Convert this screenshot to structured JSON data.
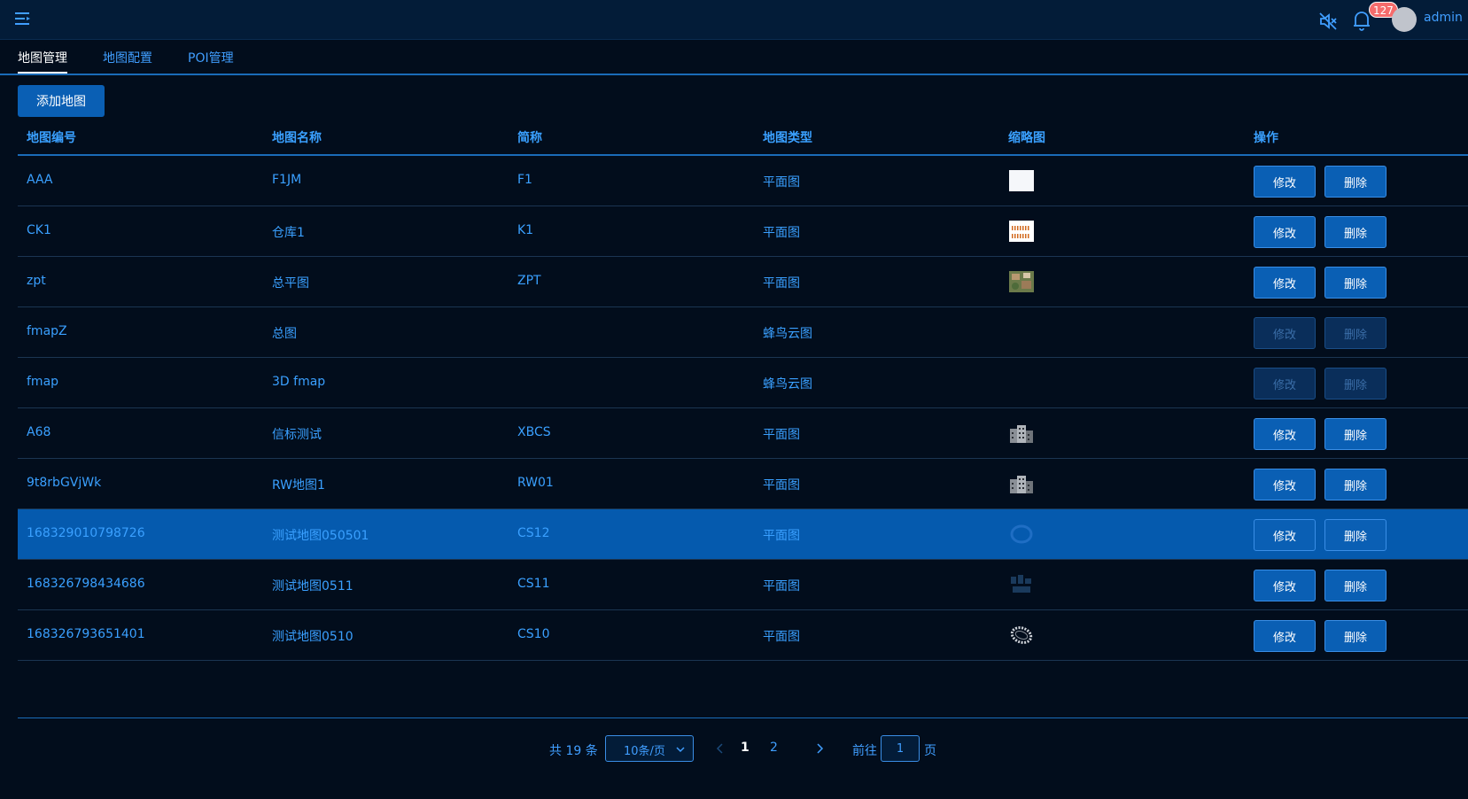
{
  "header": {
    "menu_icon": "menu-fold-icon",
    "mute_icon": "speaker-mute-icon",
    "bell_icon": "bell-icon",
    "notification_count": "127",
    "username": "admin"
  },
  "tabs": [
    {
      "label": "地图管理",
      "active": true
    },
    {
      "label": "地图配置",
      "active": false
    },
    {
      "label": "POI管理",
      "active": false
    }
  ],
  "toolbar": {
    "add_label": "添加地图"
  },
  "table": {
    "columns": [
      "地图编号",
      "地图名称",
      "简称",
      "地图类型",
      "缩略图",
      "操作"
    ],
    "edit_label": "修改",
    "delete_label": "删除",
    "rows": [
      {
        "id": "AAA",
        "name": "F1JM",
        "short": "F1",
        "type": "平面图",
        "thumb": "blank",
        "enabled": true,
        "selected": false
      },
      {
        "id": "CK1",
        "name": "仓库1",
        "short": "K1",
        "type": "平面图",
        "thumb": "shelves",
        "enabled": true,
        "selected": false
      },
      {
        "id": "zpt",
        "name": "总平图",
        "short": "ZPT",
        "type": "平面图",
        "thumb": "aerial",
        "enabled": true,
        "selected": false
      },
      {
        "id": "fmapZ",
        "name": "总图",
        "short": "",
        "type": "蜂鸟云图",
        "thumb": "none",
        "enabled": false,
        "selected": false
      },
      {
        "id": "fmap",
        "name": "3D fmap",
        "short": "",
        "type": "蜂鸟云图",
        "thumb": "none",
        "enabled": false,
        "selected": false
      },
      {
        "id": "A68",
        "name": "信标测试",
        "short": "XBCS",
        "type": "平面图",
        "thumb": "building",
        "enabled": true,
        "selected": false
      },
      {
        "id": "9t8rbGVjWk",
        "name": "RW地图1",
        "short": "RW01",
        "type": "平面图",
        "thumb": "building",
        "enabled": true,
        "selected": false
      },
      {
        "id": "168329010798726",
        "name": "测试地图050501",
        "short": "CS12",
        "type": "平面图",
        "thumb": "faint-ring",
        "enabled": true,
        "selected": true
      },
      {
        "id": "168326798434686",
        "name": "测试地图0511",
        "short": "CS11",
        "type": "平面图",
        "thumb": "faint-plan",
        "enabled": true,
        "selected": false
      },
      {
        "id": "168326793651401",
        "name": "测试地图0510",
        "short": "CS10",
        "type": "平面图",
        "thumb": "ring",
        "enabled": true,
        "selected": false
      }
    ]
  },
  "pagination": {
    "total_text": "共 19 条",
    "page_size": "10条/页",
    "pages": [
      "1",
      "2"
    ],
    "current_page": "1",
    "goto_label": "前往",
    "goto_value": "1",
    "goto_suffix": "页"
  },
  "colors": {
    "background": "#020d1c",
    "header": "#031c38",
    "accent": "#409eff",
    "button": "#0a5fb4",
    "selected_row": "#055aae",
    "badge": "#f56c6c"
  }
}
